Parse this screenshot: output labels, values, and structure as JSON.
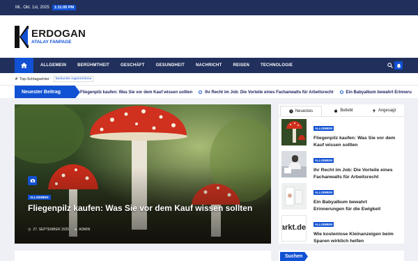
{
  "topbar": {
    "date": "Mi.. Okt. 1st, 2025",
    "time": "1:11:05 PM"
  },
  "logo": {
    "name": "ERDOGAN",
    "subtitle": "ATALAY FANPAGE"
  },
  "nav": {
    "items": [
      "ALLGEMEIN",
      "BERÜHMTHEIT",
      "GESCHÄFT",
      "GESUNDHEIT",
      "NACHRICHT",
      "REISEN",
      "TECHNOLOGIE"
    ]
  },
  "tags": {
    "label": "Top-Schlagwörter",
    "items": [
      "bedruckte regenschirme"
    ]
  },
  "ticker": {
    "label": "Neuester Beitrag",
    "items": [
      "Fliegenpilz kaufen: Was Sie vor dem Kauf wissen sollten",
      "Ihr Recht im Job: Die Vorteile eines Fachanwalts für Arbeitsrecht",
      "Ein Babyalbum bewahrt Erinneru"
    ]
  },
  "hero": {
    "category": "ALLGEMEIN",
    "title": "Fliegenpilz kaufen: Was Sie vor dem Kauf wissen sollten",
    "date": "27. SEPTEMBER 2025",
    "author": "ADMIN"
  },
  "sidebar": {
    "tabs": [
      "Neuestes",
      "Beliebt",
      "Angesagt"
    ],
    "posts": [
      {
        "category": "ALLGEMEIN",
        "title": "Fliegenpilz kaufen: Was Sie vor dem Kauf wissen sollten"
      },
      {
        "category": "ALLGEMEIN",
        "title": "Ihr Recht im Job: Die Vorteile eines Fachanwalts für Arbeitsrecht"
      },
      {
        "category": "ALLGEMEIN",
        "title": "Ein Babyalbum bewahrt Erinnerungen für die Ewigkeit"
      },
      {
        "category": "ALLGEMEIN",
        "title": "Wie kostenlose Kleinanzeigen beim Sparen wirklich helfen"
      }
    ],
    "thumb4_text": "arkt.de",
    "search_label": "Suchen"
  },
  "colors": {
    "navy": "#202f5b",
    "accent": "#1151d3"
  }
}
